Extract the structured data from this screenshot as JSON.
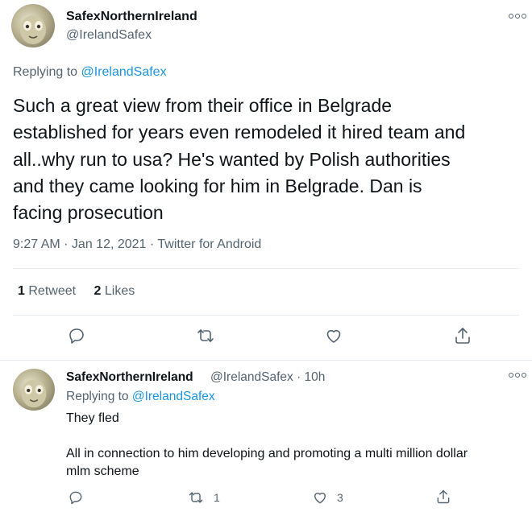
{
  "main_tweet": {
    "author": {
      "name": "SafexNorthernIreland",
      "handle": "@IrelandSafex"
    },
    "replying_to": {
      "prefix": "Replying to",
      "mention": "@IrelandSafex"
    },
    "text_lines": [
      "Such a great view from their office in Belgrade",
      "established for years even remodeled it hired team and",
      "all..why run to usa? He's wanted by Polish authorities",
      "and they came looking for him in Belgrade. Dan is",
      "facing prosecution"
    ],
    "meta": "9:27 AM · Jan 12, 2021 · Twitter for Android",
    "stats": {
      "retweets_count": "1",
      "retweets_label": "Retweet",
      "likes_count": "2",
      "likes_label": "Likes"
    }
  },
  "reply_tweet": {
    "author": {
      "name": "SafexNorthernIreland",
      "handle_time": "@IrelandSafex · 10h"
    },
    "replying_to": {
      "prefix": "Replying to",
      "mention": "@IrelandSafex"
    },
    "text_lines": [
      "They fled",
      "All in connection to him developing and promoting a multi million dollar",
      "mlm scheme"
    ],
    "actions": {
      "retweet_count": "1",
      "like_count": "3"
    }
  },
  "icons": {
    "more": "more-icon",
    "reply": "reply-icon",
    "retweet": "retweet-icon",
    "like": "heart-icon",
    "share": "share-icon"
  },
  "colors": {
    "link": "#1b95e0",
    "text": "#0f1419",
    "secondary": "#536471",
    "border": "#e6ecf0"
  }
}
